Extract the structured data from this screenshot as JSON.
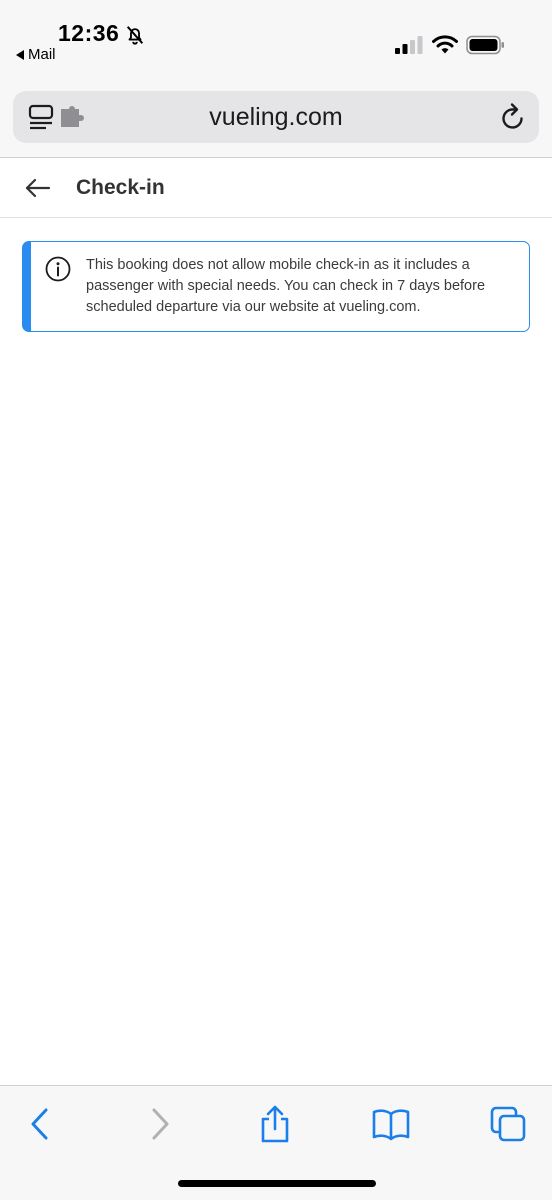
{
  "status_bar": {
    "time": "12:36",
    "back_app_label": "Mail"
  },
  "browser": {
    "url": "vueling.com"
  },
  "page": {
    "title": "Check-in",
    "alert_message": "This booking does not allow mobile check-in as it includes a passenger with special needs. You can check in 7 days before scheduled departure via our website at vueling.com."
  },
  "toolbar": {
    "buttons": [
      "back",
      "forward",
      "share",
      "bookmarks",
      "tabs"
    ]
  },
  "colors": {
    "accent": "#2a8cf0",
    "toolbar_icon": "#1a7fe8",
    "disabled_icon": "#b0b0b5"
  },
  "icons": {
    "status": [
      "bell-slash-icon",
      "signal-icon",
      "wifi-icon",
      "battery-icon"
    ],
    "url_bar": [
      "reader-icon",
      "puzzle-icon",
      "reload-icon"
    ],
    "page": [
      "back-arrow-icon",
      "info-icon"
    ]
  }
}
